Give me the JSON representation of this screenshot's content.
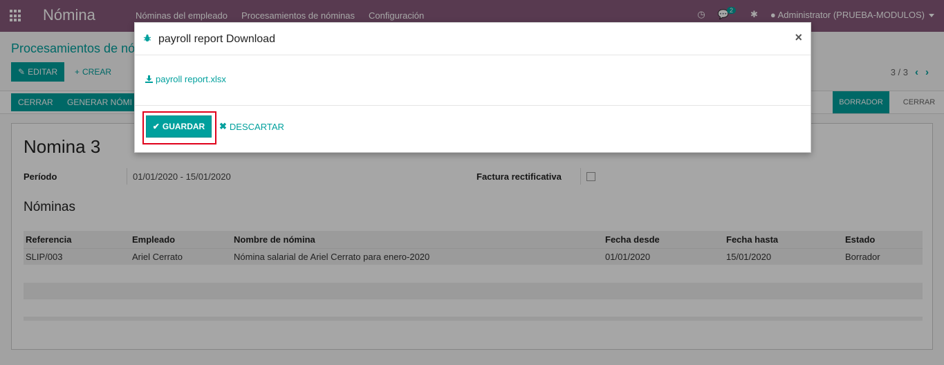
{
  "navbar": {
    "brand": "Nómina",
    "menu": [
      "Nóminas del empleado",
      "Procesamientos de nóminas",
      "Configuración"
    ],
    "chat_count": "2",
    "user": "Administrator (PRUEBA-MODULOS)",
    "bg_color": "#875a7b"
  },
  "control_panel": {
    "breadcrumb": "Procesamientos de nó",
    "edit_label": "EDITAR",
    "create_label": "CREAR",
    "pager": "3 / 3"
  },
  "action_bar": {
    "close_label": "CERRAR",
    "generate_label": "GENERAR NÓMI",
    "status_draft": "BORRADOR",
    "status_closed": "CERRAR"
  },
  "form": {
    "title": "Nomina 3",
    "period_label": "Período",
    "period_value": "01/01/2020 - 15/01/2020",
    "refund_label": "Factura rectificativa",
    "section_title": "Nóminas",
    "table": {
      "headers": [
        "Referencia",
        "Empleado",
        "Nombre de nómina",
        "Fecha desde",
        "Fecha hasta",
        "Estado"
      ],
      "rows": [
        [
          "SLIP/003",
          "Ariel Cerrato",
          "Nómina salarial de Ariel Cerrato para enero-2020",
          "01/01/2020",
          "15/01/2020",
          "Borrador"
        ]
      ]
    }
  },
  "modal": {
    "title": "payroll report Download",
    "close_glyph": "×",
    "file_link": "payroll report.xlsx",
    "save_label": "GUARDAR",
    "discard_label": "DESCARTAR",
    "accent_color": "#00a09d",
    "highlight_color": "#e0001b"
  }
}
